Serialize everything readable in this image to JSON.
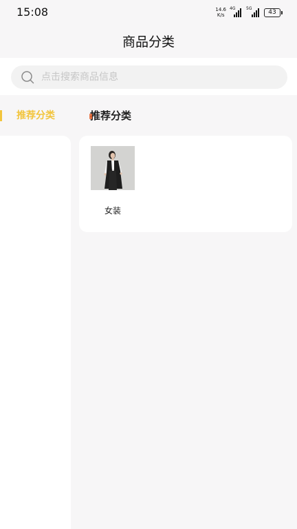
{
  "status_bar": {
    "time": "15:08",
    "net_speed_value": "14.6",
    "net_speed_unit": "K/s",
    "signal_1_label": "4G",
    "signal_2_label": "5G",
    "battery": "43"
  },
  "header": {
    "title": "商品分类"
  },
  "search": {
    "placeholder": "点击搜索商品信息",
    "value": ""
  },
  "sidebar": {
    "items": [
      {
        "label": "推荐分类",
        "active": true
      }
    ],
    "accent_color": "#f2c53d"
  },
  "main": {
    "section_title": "推荐分类",
    "categories": [
      {
        "name": "女装",
        "image": "woman-in-black-vest-photo"
      }
    ]
  }
}
